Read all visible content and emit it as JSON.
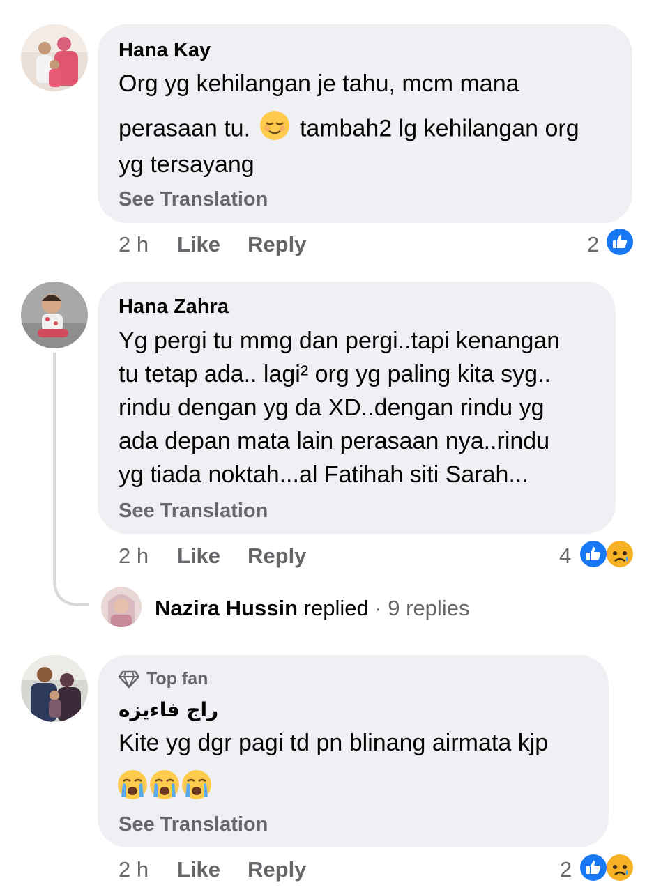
{
  "comments": [
    {
      "author": "Hana Kay",
      "lines": [
        "Org yg kehilangan je tahu, mcm mana",
        "perasaan tu.",
        "tambah2 lg kehilangan org",
        "yg tersayang"
      ],
      "see_translation": "See Translation",
      "time": "2 h",
      "like": "Like",
      "reply": "Reply",
      "reaction_count": "2",
      "reactions": [
        "like-icon"
      ]
    },
    {
      "author": "Hana Zahra",
      "lines": [
        "Yg pergi tu mmg dan pergi..tapi kenangan",
        "tu tetap ada.. lagi² org yg paling kita syg..",
        "rindu dengan yg da XD..dengan rindu yg",
        "ada depan mata lain perasaan nya..rindu",
        "yg tiada noktah...al Fatihah siti Sarah..."
      ],
      "see_translation": "See Translation",
      "time": "2 h",
      "like": "Like",
      "reply": "Reply",
      "reaction_count": "4",
      "reactions": [
        "like-icon",
        "sad-icon"
      ],
      "replies": {
        "name": "Nazira Hussin",
        "action": "replied",
        "summary": "· 9 replies"
      }
    },
    {
      "badge": "Top fan",
      "author": "راج فاءيزه",
      "lines": [
        "Kite yg dgr pagi td pn blinang airmata kjp"
      ],
      "see_translation": "See Translation",
      "time": "2 h",
      "like": "Like",
      "reply": "Reply",
      "reaction_count": "2",
      "reactions": [
        "like-icon",
        "sad-icon"
      ]
    }
  ],
  "colors": {
    "bubble": "#eff0f3",
    "secondary_text": "#65676b",
    "like_blue": "#1877f2",
    "sad_yellow": "#f7b125"
  }
}
